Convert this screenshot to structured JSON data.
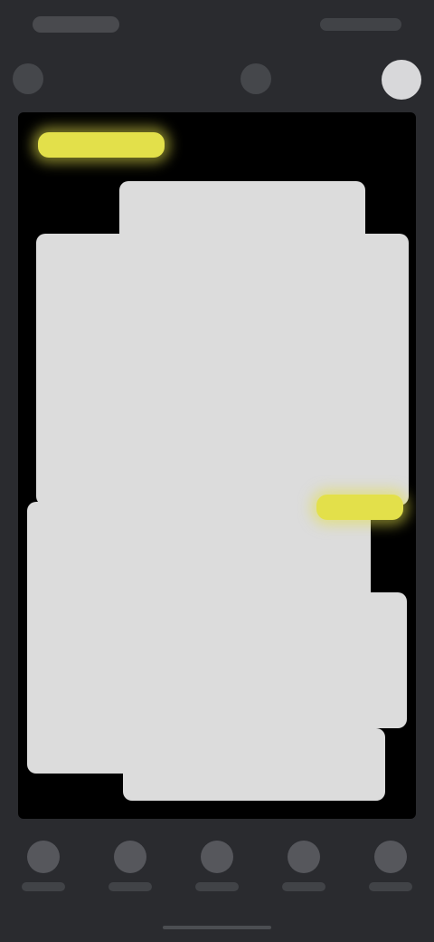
{
  "status_bar": {
    "time": "",
    "indicators": ""
  },
  "toolbar": {
    "back_icon": "back-icon",
    "center_icon": "crop-icon",
    "right_icon": "avatar-icon"
  },
  "canvas": {
    "tags": [
      {
        "label": ""
      },
      {
        "label": ""
      }
    ]
  },
  "bottom_nav": {
    "items": [
      {
        "icon": "edit-icon",
        "label": ""
      },
      {
        "icon": "filter-icon",
        "label": ""
      },
      {
        "icon": "adjust-icon",
        "label": ""
      },
      {
        "icon": "text-icon",
        "label": ""
      },
      {
        "icon": "more-icon",
        "label": ""
      }
    ]
  },
  "colors": {
    "background": "#2a2b2f",
    "canvas": "#000000",
    "document": "#dcdcdc",
    "highlight": "#e3e04a"
  }
}
